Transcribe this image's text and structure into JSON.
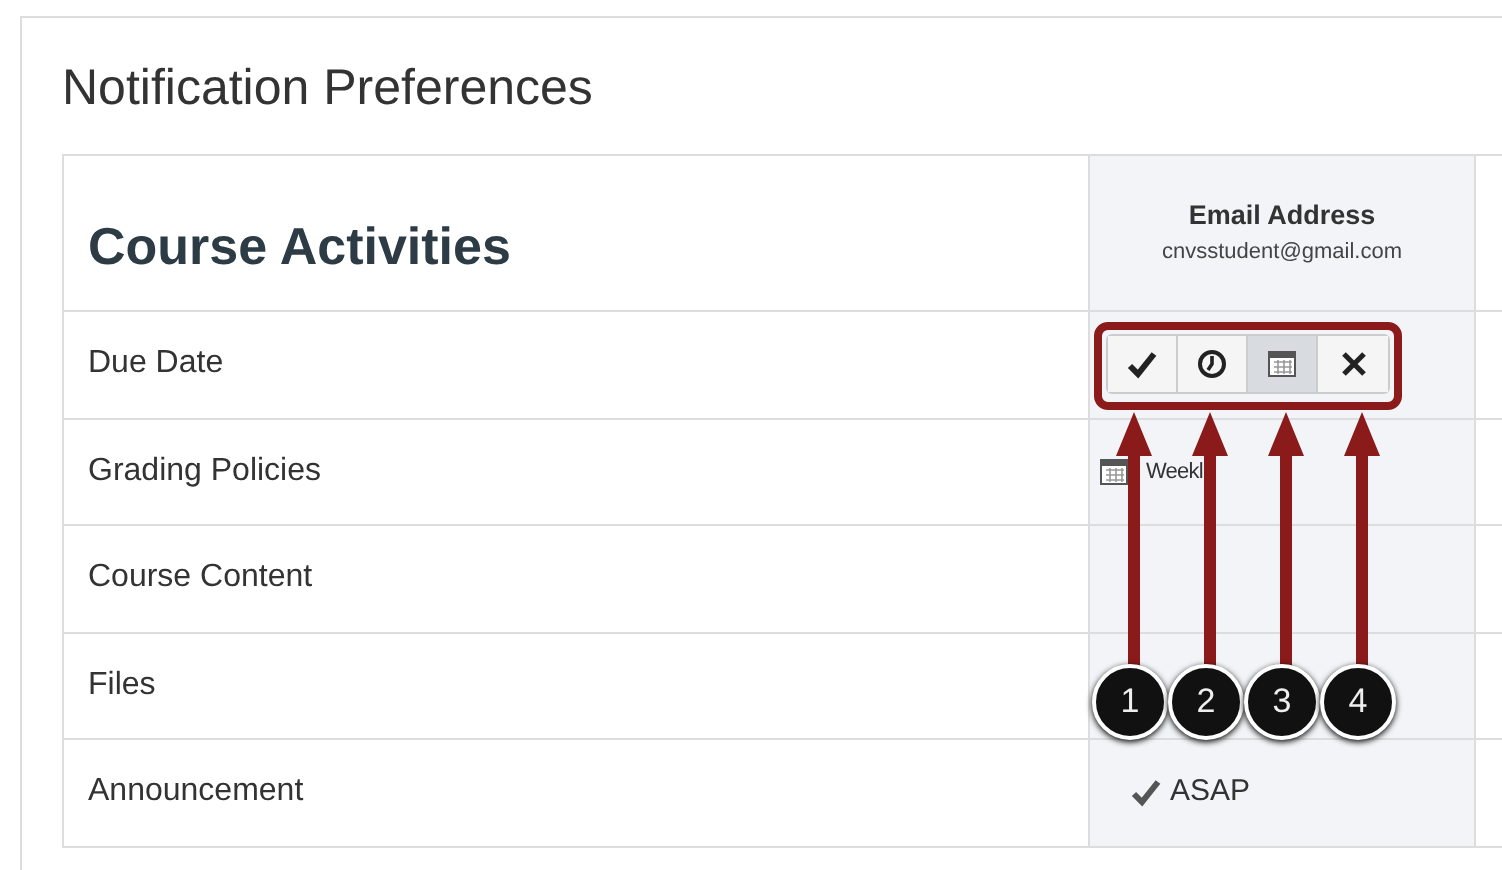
{
  "title": "Notification Preferences",
  "table": {
    "heading": "Course Activities",
    "channel": {
      "name": "Email Address",
      "address": "cnvsstudent@gmail.com"
    },
    "rows": [
      {
        "label": "Due Date",
        "setting": {
          "kind": "buttons",
          "options": [
            {
              "selected": false
            },
            {
              "selected": false
            },
            {
              "selected": true
            },
            {
              "selected": false
            }
          ]
        }
      },
      {
        "label": "Grading Policies",
        "setting": {
          "kind": "scheduled",
          "text": "Weekl"
        }
      },
      {
        "label": "Course Content",
        "setting": {
          "kind": "none"
        }
      },
      {
        "label": "Files",
        "setting": {
          "kind": "none"
        }
      },
      {
        "label": "Announcement",
        "setting": {
          "kind": "instant",
          "text": "ASAP"
        }
      }
    ]
  },
  "callouts": [
    "1",
    "2",
    "3",
    "4"
  ]
}
